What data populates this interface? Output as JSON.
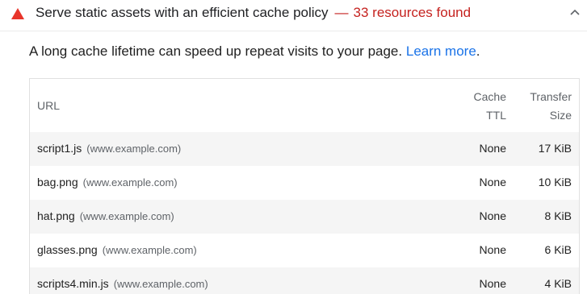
{
  "audit": {
    "title": "Serve static assets with an efficient cache policy",
    "dash": "—",
    "found": "33 resources found",
    "status_color": "#c5221f",
    "icon": "warning-triangle-icon"
  },
  "description": {
    "text": "A long cache lifetime can speed up repeat visits to your page.",
    "link": "Learn more",
    "period": "."
  },
  "table": {
    "headers": {
      "url": "URL",
      "cache_ttl_line1": "Cache",
      "cache_ttl_line2": "TTL",
      "size_line1": "Transfer",
      "size_line2": "Size"
    },
    "rows": [
      {
        "file": "script1.js",
        "host": "(www.example.com)",
        "ttl": "None",
        "size": "17 KiB"
      },
      {
        "file": "bag.png",
        "host": "(www.example.com)",
        "ttl": "None",
        "size": "10 KiB"
      },
      {
        "file": "hat.png",
        "host": "(www.example.com)",
        "ttl": "None",
        "size": "8 KiB"
      },
      {
        "file": "glasses.png",
        "host": "(www.example.com)",
        "ttl": "None",
        "size": "6 KiB"
      },
      {
        "file": "scripts4.min.js",
        "host": "(www.example.com)",
        "ttl": "None",
        "size": "4 KiB"
      }
    ]
  }
}
